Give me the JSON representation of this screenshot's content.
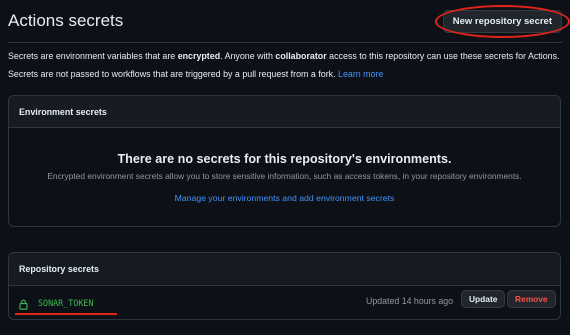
{
  "header": {
    "title": "Actions secrets",
    "new_secret_label": "New repository secret"
  },
  "description": {
    "line1": {
      "pre": "Secrets are environment variables that are ",
      "bold1": "encrypted",
      "mid": ". Anyone with ",
      "bold2": "collaborator",
      "post": " access to this repository can use these secrets for Actions."
    },
    "line2": {
      "text": "Secrets are not passed to workflows that are triggered by a pull request from a fork. ",
      "link": "Learn more"
    }
  },
  "environment_secrets": {
    "heading": "Environment secrets",
    "empty_title": "There are no secrets for this repository's environments.",
    "empty_desc": "Encrypted environment secrets allow you to store sensitive information, such as access tokens, in your repository environments.",
    "manage_link": "Manage your environments and add environment secrets"
  },
  "repository_secrets": {
    "heading": "Repository secrets",
    "items": [
      {
        "icon": "lock-icon",
        "name": "SONAR_TOKEN",
        "updated": "Updated 14 hours ago",
        "update_label": "Update",
        "remove_label": "Remove"
      }
    ]
  },
  "colors": {
    "background": "#0d1117",
    "border": "#30363d",
    "link": "#4493f8",
    "secret_name": "#3fb950",
    "danger": "#f85149",
    "annotation": "#e3241b"
  }
}
